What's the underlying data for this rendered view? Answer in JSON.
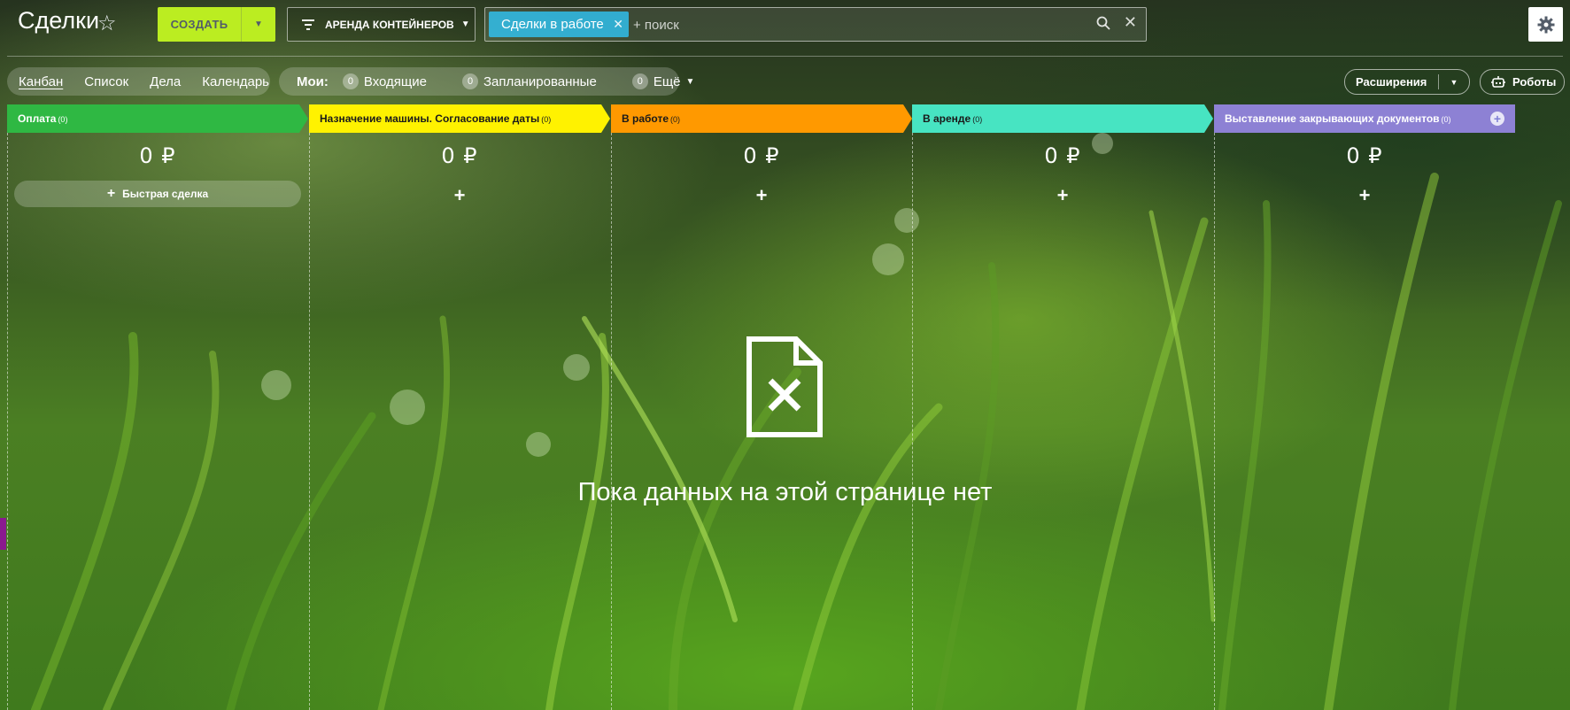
{
  "header": {
    "title": "Сделки",
    "create_label": "СОЗДАТЬ",
    "category_label": "АРЕНДА КОНТЕЙНЕРОВ",
    "filter_chip": "Сделки в работе",
    "search_placeholder": "+ поиск"
  },
  "toolbar": {
    "views": [
      {
        "label": "Канбан",
        "active": true
      },
      {
        "label": "Список"
      },
      {
        "label": "Дела"
      },
      {
        "label": "Календарь"
      }
    ],
    "my_label": "Мои:",
    "counters": [
      {
        "count": "0",
        "label": "Входящие"
      },
      {
        "count": "0",
        "label": "Запланированные"
      },
      {
        "count": "0",
        "label": "Ещё"
      }
    ],
    "extensions_label": "Расширения",
    "robots_label": "Роботы"
  },
  "kanban": {
    "columns": [
      {
        "title": "Оплата",
        "count": "(0)",
        "sum": "0 ₽",
        "color": "#2fb843",
        "text_color": "#ffffff"
      },
      {
        "title": "Назначение машины. Согласование даты",
        "count": "(0)",
        "sum": "0 ₽",
        "color": "#fff200",
        "text_color": "#1a1a1a"
      },
      {
        "title": "В работе",
        "count": "(0)",
        "sum": "0 ₽",
        "color": "#ff9900",
        "text_color": "#1a1a1a"
      },
      {
        "title": "В аренде",
        "count": "(0)",
        "sum": "0 ₽",
        "color": "#47e4c2",
        "text_color": "#1a1a1a"
      },
      {
        "title": "Выставление закрывающих документов",
        "count": "(0)",
        "sum": "0 ₽",
        "color": "#8d81d4",
        "text_color": "#ffffff"
      }
    ],
    "quick_deal_label": "Быстрая сделка"
  },
  "empty_state": {
    "text": "Пока данных на этой странице нет"
  }
}
